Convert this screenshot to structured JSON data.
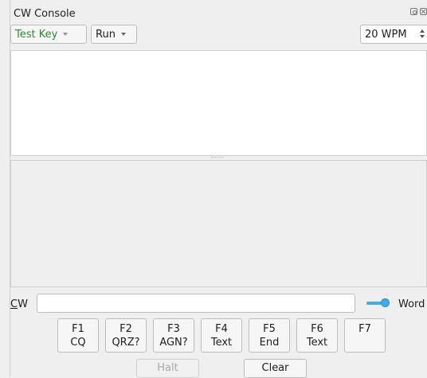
{
  "window": {
    "title": "CW Console",
    "float_icon": "float-icon",
    "close_icon": "close-icon"
  },
  "toolbar": {
    "test_key": {
      "label": "Test Key",
      "icon": "chevron-down-icon",
      "color": "#2b8a2b"
    },
    "mode": {
      "label": "Run",
      "icon": "chevron-down-icon"
    },
    "speed": {
      "value": "20 WPM",
      "icon": "spin-arrows-icon"
    }
  },
  "cw_entry": {
    "label_mnemonic": "C",
    "label_rest": "W",
    "value": "",
    "word_toggle": {
      "label": "Word",
      "on": true,
      "color": "#3daee9"
    }
  },
  "function_keys": [
    {
      "key": "F1",
      "label": "CQ"
    },
    {
      "key": "F2",
      "label": "QRZ?"
    },
    {
      "key": "F3",
      "label": "AGN?"
    },
    {
      "key": "F4",
      "label": "Text"
    },
    {
      "key": "F5",
      "label": "End"
    },
    {
      "key": "F6",
      "label": "Text"
    },
    {
      "key": "F7",
      "label": ""
    }
  ],
  "commands": {
    "halt": {
      "label": "Halt",
      "enabled": false
    },
    "clear": {
      "label": "Clear",
      "enabled": true
    }
  }
}
